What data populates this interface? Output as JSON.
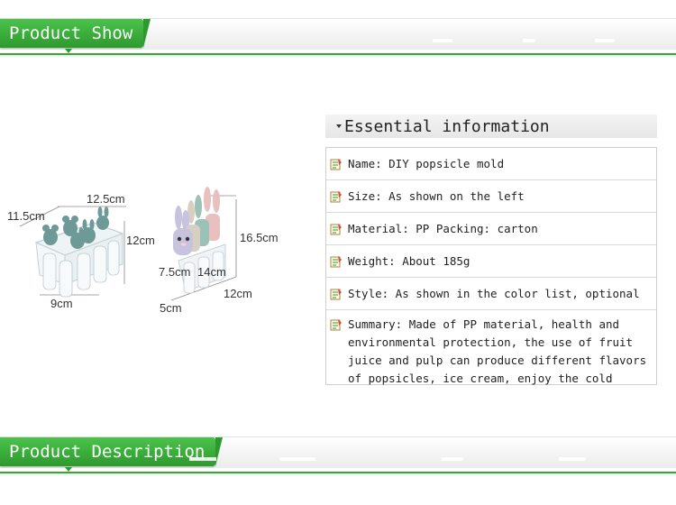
{
  "sections": {
    "top": {
      "title": "Product Show"
    },
    "bottom": {
      "title": "Product Description"
    }
  },
  "product_figure": {
    "left_mold": {
      "width": "12.5cm",
      "depth": "11.5cm",
      "height": "12cm",
      "base": "9cm"
    },
    "right_mold": {
      "height": "16.5cm",
      "width": "7.5cm",
      "depth": "14cm",
      "base_depth": "12cm",
      "base_width": "5cm"
    }
  },
  "info": {
    "header": "Essential information",
    "rows": [
      {
        "text": "Name: DIY popsicle mold"
      },
      {
        "text": "Size: As shown on the left"
      },
      {
        "text": "Material: PP Packing: carton"
      },
      {
        "text": "Weight: About 185g"
      },
      {
        "text": "Style: As shown in the color list, optional"
      },
      {
        "text": "Summary: Made of PP material, health and environmental protection, the use of fruit juice and pulp can produce different flavors of popsicles, ice cream, enjoy the cold summer"
      }
    ]
  },
  "colors": {
    "accent_green": "#3aa63a",
    "tab_green_top": "#4bc24b",
    "tab_green_bottom": "#2d9a2d"
  },
  "icons": {
    "row_bullet": "note-icon",
    "header_caret": "caret-down-icon"
  }
}
